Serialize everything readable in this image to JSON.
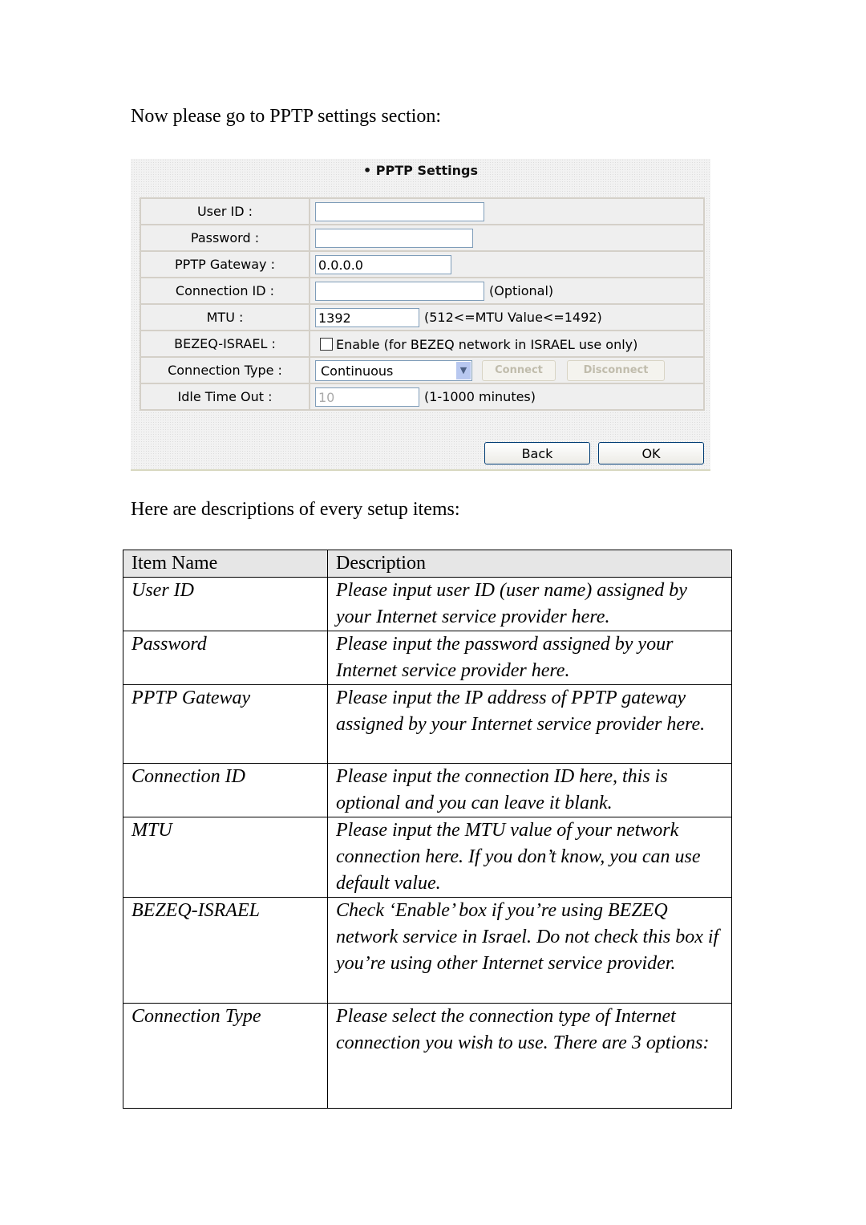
{
  "intro": "Now please go to PPTP settings section:",
  "panel": {
    "title": "PPTP Settings",
    "rows": [
      {
        "label": "User ID :",
        "value": "",
        "hint": ""
      },
      {
        "label": "Password :",
        "value": "",
        "hint": ""
      },
      {
        "label": "PPTP Gateway :",
        "value": "0.0.0.0",
        "hint": ""
      },
      {
        "label": "Connection ID :",
        "value": "",
        "hint": "(Optional)"
      },
      {
        "label": "MTU :",
        "value": "1392",
        "hint": "(512<=MTU Value<=1492)"
      },
      {
        "label": "BEZEQ-ISRAEL :",
        "checkbox_label": "Enable (for BEZEQ network in ISRAEL use only)",
        "checked": false
      },
      {
        "label": "Connection Type :",
        "selected": "Continuous",
        "connect": "Connect",
        "disconnect": "Disconnect"
      },
      {
        "label": "Idle Time Out :",
        "value": "10",
        "hint": "(1-1000 minutes)"
      }
    ],
    "back": "Back",
    "ok": "OK"
  },
  "desc_intro": "Here are descriptions of every setup items:",
  "table": {
    "headers": [
      "Item Name",
      "Description"
    ],
    "rows": [
      {
        "name": "User ID",
        "desc": "Please input user ID (user name) assigned by your Internet service provider here."
      },
      {
        "name": "Password",
        "desc": "Please input the password assigned by your Internet service provider here."
      },
      {
        "name": "PPTP Gateway",
        "desc": "Please input the IP address of PPTP gateway assigned by your Internet service provider here."
      },
      {
        "name": "Connection ID",
        "desc": "Please input the connection ID here, this is optional and you can leave it blank."
      },
      {
        "name": "MTU",
        "desc": "Please input the MTU value of your network connection here. If you don’t know, you can use default value."
      },
      {
        "name": "BEZEQ-ISRAEL",
        "desc": "Check ‘Enable’ box if you’re using BEZEQ network service in Israel. Do not check this box if you’re using other Internet service provider."
      },
      {
        "name": "Connection Type",
        "desc": "Please select the connection type of Internet connection you wish to use. There are 3 options:"
      }
    ]
  }
}
